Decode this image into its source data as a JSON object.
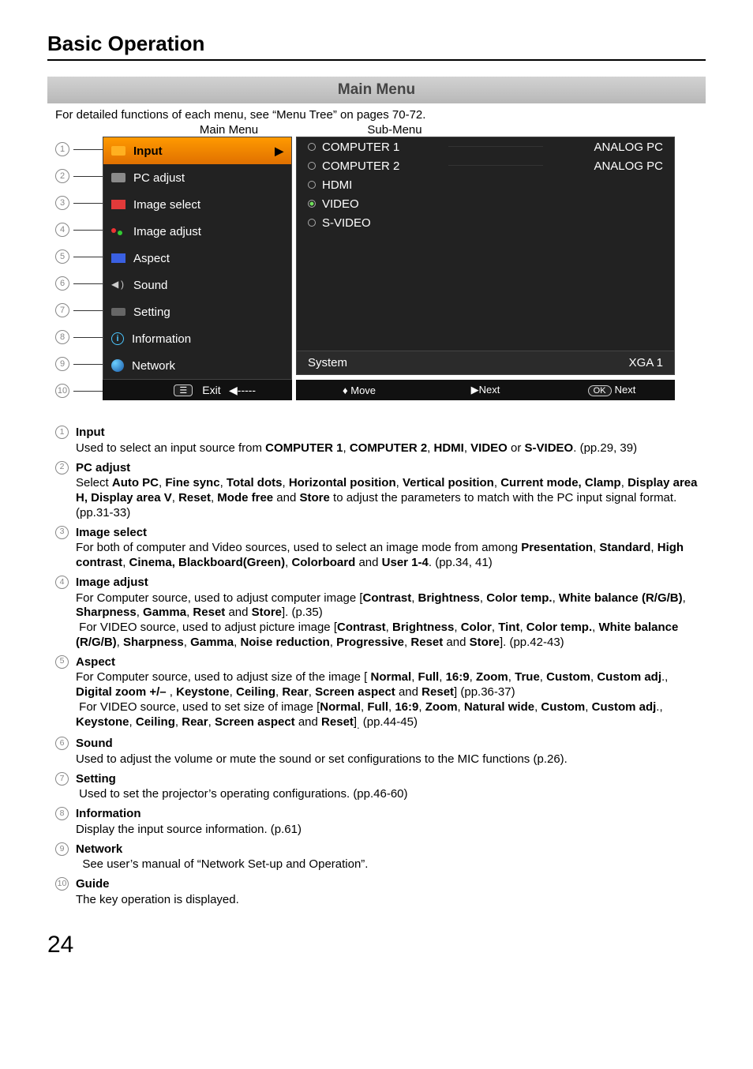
{
  "heading": "Basic Operation",
  "title_bar": "Main Menu",
  "detailed_note": "For detailed functions of each menu, see “Menu Tree” on pages 70-72.",
  "label_main": "Main Menu",
  "label_sub": "Sub-Menu",
  "numbers": [
    "1",
    "2",
    "3",
    "4",
    "5",
    "6",
    "7",
    "8",
    "9",
    "10"
  ],
  "main_items": [
    {
      "label": "Input",
      "sel": true
    },
    {
      "label": "PC adjust"
    },
    {
      "label": "Image select"
    },
    {
      "label": "Image adjust"
    },
    {
      "label": "Aspect"
    },
    {
      "label": "Sound"
    },
    {
      "label": "Setting"
    },
    {
      "label": "Information"
    },
    {
      "label": "Network"
    }
  ],
  "sub_items": [
    {
      "label": "COMPUTER 1",
      "right": "ANALOG PC",
      "on": false
    },
    {
      "label": "COMPUTER 2",
      "right": "ANALOG PC",
      "on": false
    },
    {
      "label": "HDMI",
      "right": "",
      "on": false
    },
    {
      "label": "VIDEO",
      "right": "",
      "on": true
    },
    {
      "label": "S-VIDEO",
      "right": "",
      "on": false
    }
  ],
  "system_row": {
    "left": "System",
    "right": "XGA 1"
  },
  "exit_label": "Exit",
  "guide": {
    "back": "-----",
    "move": "Move",
    "next": "Next",
    "ok": "OK",
    "oknext": "Next"
  },
  "descs": [
    {
      "n": "1",
      "t": "Input",
      "d": "Used to select an input source from <b>COMPUTER 1</b>, <b>COMPUTER 2</b>, <b>HDMI</b>, <b>VIDEO</b> or <b>S-VIDEO</b>. (pp.29, 39)"
    },
    {
      "n": "2",
      "t": "PC adjust",
      "d": "Select <b>Auto PC</b>, <b>Fine sync</b>, <b>Total dots</b>, <b>Horizontal position</b>, <b>Vertical position</b>, <b>Current mode, Clamp</b>, <b>Display area H, Display area V</b>, <b>Reset</b>, <b>Mode free</b> and <b>Store</b> to adjust the parameters to match with the PC input signal format. (pp.31-33)"
    },
    {
      "n": "3",
      "t": "Image select",
      "d": "For both of computer and Video sources, used to select an image mode from among <b>Presentation</b>, <b>Standard</b>, <b>High contrast</b>, <b>Cinema, Blackboard(Green)</b>,  <b>Colorboard</b> and <b>User 1-4</b>. (pp.34, 41)"
    },
    {
      "n": "4",
      "t": "Image adjust",
      "d": "For Computer source, used to adjust computer image [<b>Contrast</b>, <b>Brightness</b>, <b>Color temp.</b>, <b>White balance (R/G/B)</b>, <b>Sharpness</b>, <b>Gamma</b>, <b>Reset</b> and <b>Store</b>]. (p.35)<br>&nbsp;For VIDEO source, used to adjust picture image [<b>Contrast</b>, <b>Brightness</b>, <b>Color</b>, <b>Tint</b>, <b>Color temp.</b>, <b>White balance (R/G/B)</b>, <b>Sharpness</b>, <b>Gamma</b>, <b>Noise reduction</b>, <b>Progressive</b>, <b>Reset</b> and <b>Store</b>]. (pp.42-43)"
    },
    {
      "n": "5",
      "t": "Aspect",
      "d": "For Computer source, used to adjust size of the image [ <b>Normal</b>, <b>Full</b>, <b>16:9</b>, <b>Zoom</b>, <b>True</b>, <b>Custom</b>, <b>Custom adj</b>., <b>Digital zoom +/–</b> , <b>Keystone</b>, <b>Ceiling</b>, <b>Rear</b>, <b>Screen aspect</b> and <b>Reset</b>]  (pp.36-37)<br>&nbsp;For VIDEO source, used to set size of image [<b>Normal</b>, <b>Full</b>, <b>16:9</b>, <b>Zoom</b>, <b>Natural wide</b>, <b>Custom</b>, <b>Custom adj</b>., <b>Keystone</b>, <b>Ceiling</b>, <b>Rear</b>, <b>Screen aspect</b> and <b>Reset</b>]<sub>.</sub> (pp.44-45)"
    },
    {
      "n": "6",
      "t": "Sound",
      "d": "Used to adjust the volume or mute the sound or set configurations to the MIC functions (p.26)."
    },
    {
      "n": "7",
      "t": "Setting",
      "d": "&nbsp;Used to set the projector’s operating configurations. (pp.46-60)"
    },
    {
      "n": "8",
      "t": "Information",
      "d": "Display the input source information. (p.61)"
    },
    {
      "n": "9",
      "t": "Network",
      "d": "&nbsp;&nbsp;See user’s manual of “Network Set-up and Operation”."
    },
    {
      "n": "10",
      "t": "Guide",
      "d": "The key operation is displayed."
    }
  ],
  "page_number": "24"
}
